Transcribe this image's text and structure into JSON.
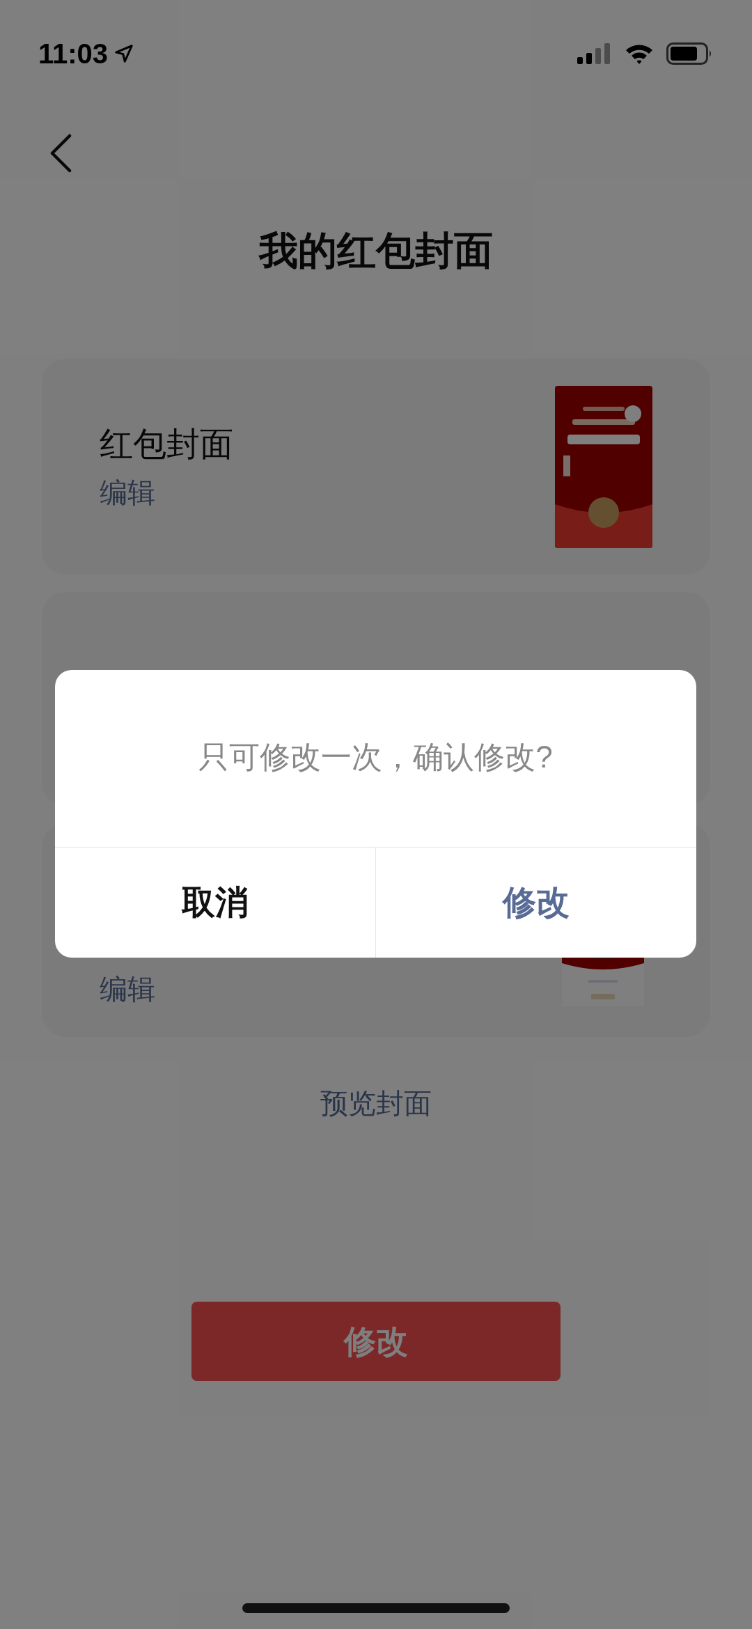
{
  "status_bar": {
    "time": "11:03"
  },
  "title": "我的红包封面",
  "cards": [
    {
      "title": "红包封面",
      "action": "编辑"
    },
    {
      "action": "编辑"
    }
  ],
  "preview_link": "预览封面",
  "primary_button": "修改",
  "dialog": {
    "message": "只可修改一次，确认修改?",
    "buttons": [
      {
        "label": "取消",
        "kind": "cancel"
      },
      {
        "label": "修改",
        "kind": "confirm"
      }
    ]
  }
}
